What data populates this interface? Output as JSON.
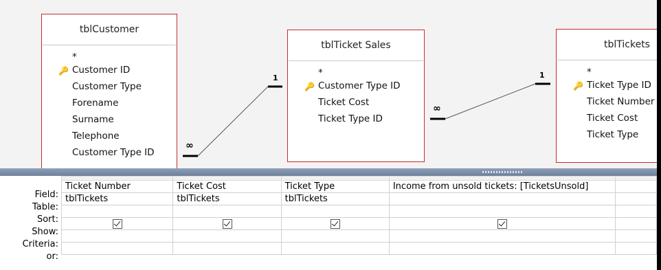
{
  "tables": [
    {
      "name": "tblCustomer",
      "fields": [
        "*",
        "Customer ID",
        "Customer Type",
        "Forename",
        "Surname",
        "Telephone",
        "Customer Type ID"
      ],
      "key": "Customer ID"
    },
    {
      "name": "tblTicket Sales",
      "fields": [
        "*",
        "Customer Type ID",
        "Ticket Cost",
        "Ticket Type ID"
      ],
      "key": "Customer Type ID"
    },
    {
      "name": "tblTickets",
      "fields": [
        "*",
        "Ticket Type ID",
        "Ticket Number",
        "Ticket Cost",
        "Ticket Type"
      ],
      "key": "Ticket Type ID"
    }
  ],
  "relationships": [
    {
      "one": "1",
      "many": "∞"
    },
    {
      "one": "1",
      "many": "∞"
    }
  ],
  "row_labels": [
    "Field:",
    "Table:",
    "Sort:",
    "Show:",
    "Criteria:",
    "or:"
  ],
  "columns": [
    {
      "field": "Ticket Number",
      "table": "tblTickets",
      "show": true
    },
    {
      "field": "Ticket Cost",
      "table": "tblTickets",
      "show": true
    },
    {
      "field": "Ticket Type",
      "table": "tblTickets",
      "show": true
    },
    {
      "field": "Income from unsold tickets: [TicketsUnsold]",
      "table": "",
      "show": true
    }
  ],
  "colors": {
    "table_border": "#c62b2b",
    "splitter": "#7a8ca7",
    "key": "#b8860b"
  }
}
